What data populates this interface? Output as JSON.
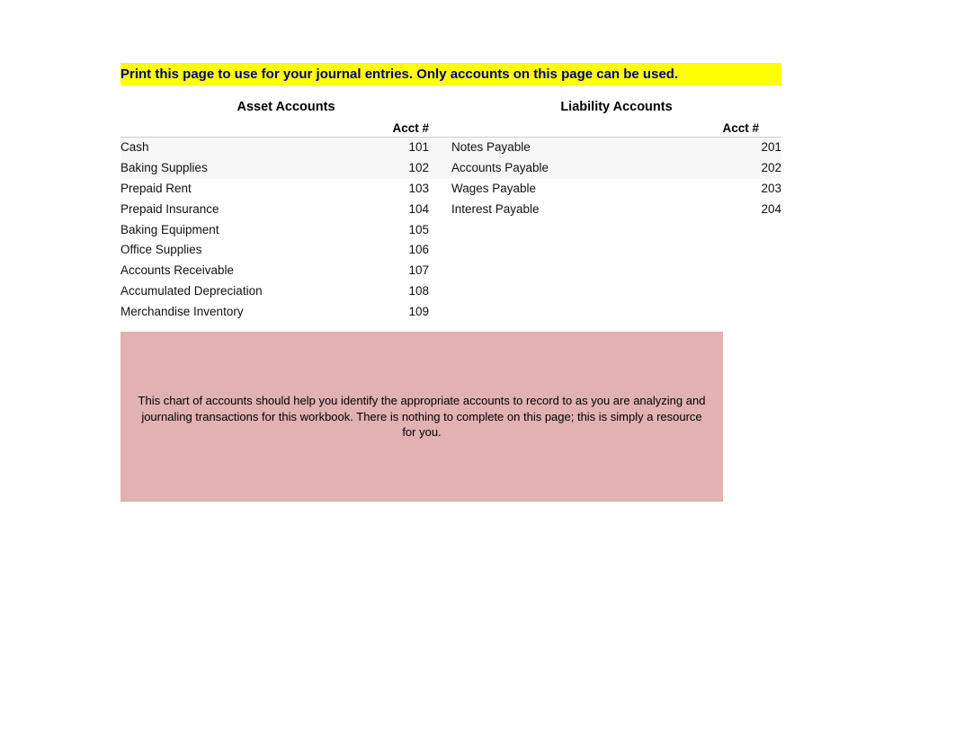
{
  "banner_text": "Print this page to use for your journal entries.  Only accounts on this page can be used.",
  "asset_heading": "Asset Accounts",
  "liability_heading": "Liability Accounts",
  "acct_col_label": "Acct #",
  "asset_accounts": [
    {
      "name": "Cash",
      "num": "101"
    },
    {
      "name": "Baking Supplies",
      "num": "102"
    },
    {
      "name": "Prepaid Rent",
      "num": "103"
    },
    {
      "name": "Prepaid Insurance",
      "num": "104"
    },
    {
      "name": "Baking Equipment",
      "num": "105"
    },
    {
      "name": "Office Supplies",
      "num": "106"
    },
    {
      "name": "Accounts Receivable",
      "num": "107"
    },
    {
      "name": "Accumulated Depreciation",
      "num": "108"
    },
    {
      "name": "Merchandise Inventory",
      "num": "109"
    }
  ],
  "liability_accounts": [
    {
      "name": "Notes Payable",
      "num": "201"
    },
    {
      "name": "Accounts Payable",
      "num": "202"
    },
    {
      "name": "Wages Payable",
      "num": "203"
    },
    {
      "name": "Interest Payable",
      "num": "204"
    }
  ],
  "note_text": "This chart of accounts should help you identify the appropriate accounts to record to as you are analyzing and journaling transactions for this workbook. There is nothing to complete on this page; this is simply a resource for you."
}
